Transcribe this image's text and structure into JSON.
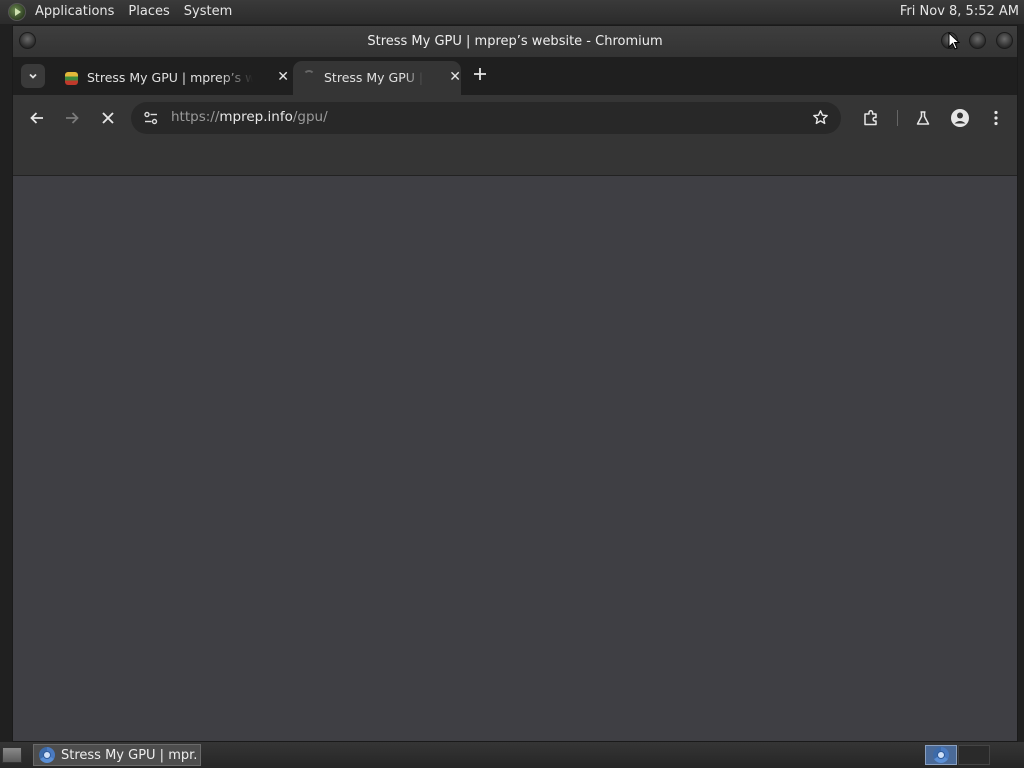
{
  "top_panel": {
    "menus": [
      "Applications",
      "Places",
      "System"
    ],
    "clock": "Fri Nov  8,  5:52 AM"
  },
  "window": {
    "title": "Stress My GPU | mprep’s website - Chromium"
  },
  "tabs": [
    {
      "title": "Stress My GPU | mprep’s website",
      "active": false
    },
    {
      "title": "Stress My GPU | mprep’s website",
      "active": true,
      "loading": true
    }
  ],
  "toolbar": {
    "url_scheme": "https://",
    "url_host": "mprep.info",
    "url_path": "/gpu/",
    "icons": [
      "back-arrow-icon",
      "forward-arrow-icon",
      "stop-icon",
      "site-info-icon",
      "star-icon",
      "extensions-icon",
      "labs-flask-icon",
      "profile-icon",
      "menu-icon"
    ]
  },
  "taskbar": {
    "task_label": "Stress My GPU | mpr..."
  },
  "colors": {
    "page_background": "#3f3f44",
    "toolbar": "#353535",
    "tabstrip": "#1f1f1f"
  }
}
